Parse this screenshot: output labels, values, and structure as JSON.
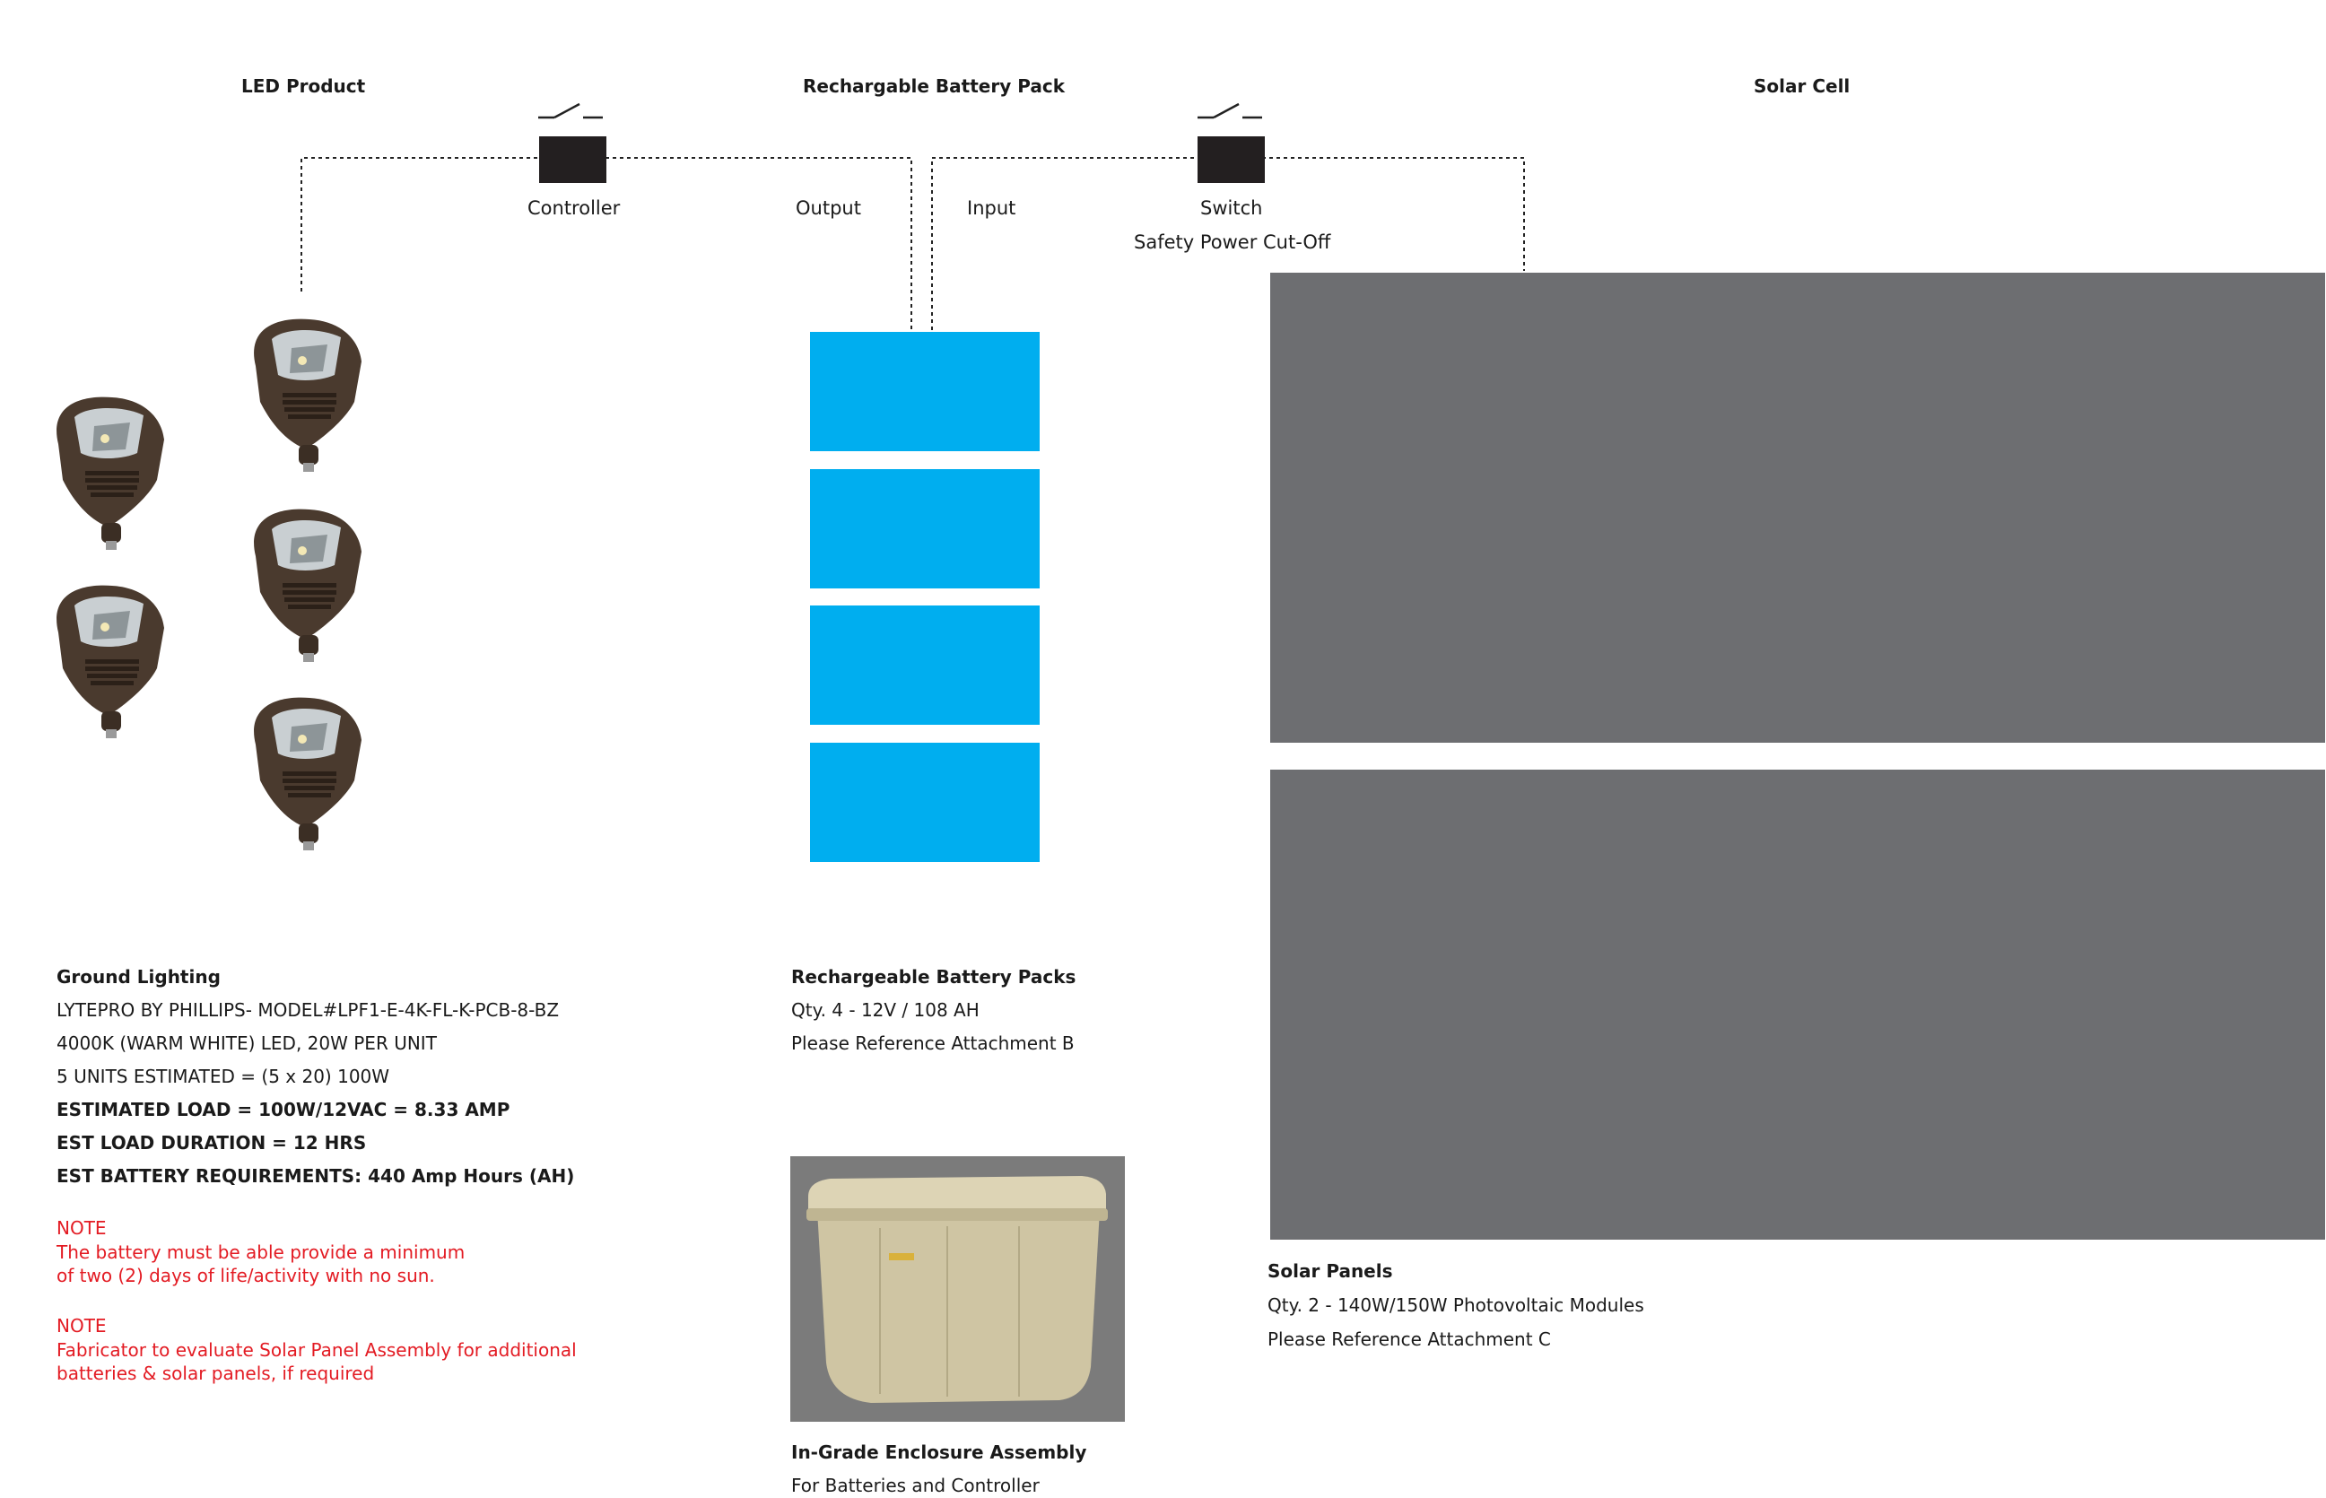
{
  "headers": {
    "led_product": "LED Product",
    "battery_pack": "Rechargable Battery Pack",
    "solar_cell": "Solar Cell"
  },
  "labels": {
    "controller": "Controller",
    "output": "Output",
    "input": "Input",
    "switch": "Switch",
    "safety": "Safety Power Cut-Off"
  },
  "ground_lighting": {
    "title": "Ground Lighting",
    "lines": [
      "LYTEPRO BY PHILLIPS- MODEL#LPF1-E-4K-FL-K-PCB-8-BZ",
      "4000K (WARM WHITE) LED, 20W PER UNIT",
      "5 UNITS ESTIMATED = (5 x 20) 100W"
    ],
    "bold_lines": [
      "ESTIMATED LOAD = 100W/12VAC = 8.33 AMP",
      "EST LOAD DURATION = 12 HRS",
      "EST BATTERY REQUIREMENTS: 440 Amp Hours (AH)"
    ]
  },
  "notes": [
    {
      "title": "NOTE",
      "lines": [
        "The battery must be able provide a minimum",
        "of two (2) days of life/activity with no sun."
      ]
    },
    {
      "title": "NOTE",
      "lines": [
        "Fabricator to evaluate Solar Panel Assembly for additional",
        "batteries & solar panels, if required"
      ]
    }
  ],
  "battery_packs": {
    "title": "Rechargeable Battery Packs",
    "lines": [
      "Qty. 4 - 12V / 108 AH",
      "Please Reference Attachment B"
    ]
  },
  "enclosure": {
    "title": "In-Grade Enclosure Assembly",
    "lines": [
      "For Batteries and Controller"
    ]
  },
  "solar_panels": {
    "title": "Solar Panels",
    "lines": [
      "Qty. 2 - 140W/150W Photovoltaic Modules",
      "Please Reference Attachment C"
    ]
  },
  "colors": {
    "battery": "#00aeef",
    "panel": "#6d6e71",
    "note": "#e31b23",
    "device": "#231f20",
    "fixture_body": "#4a3a2e"
  },
  "icons": {
    "fixture": "led-flood-light-icon",
    "controller": "controller-box-icon",
    "switch": "switch-symbol-icon",
    "enclosure": "enclosure-box-icon"
  }
}
